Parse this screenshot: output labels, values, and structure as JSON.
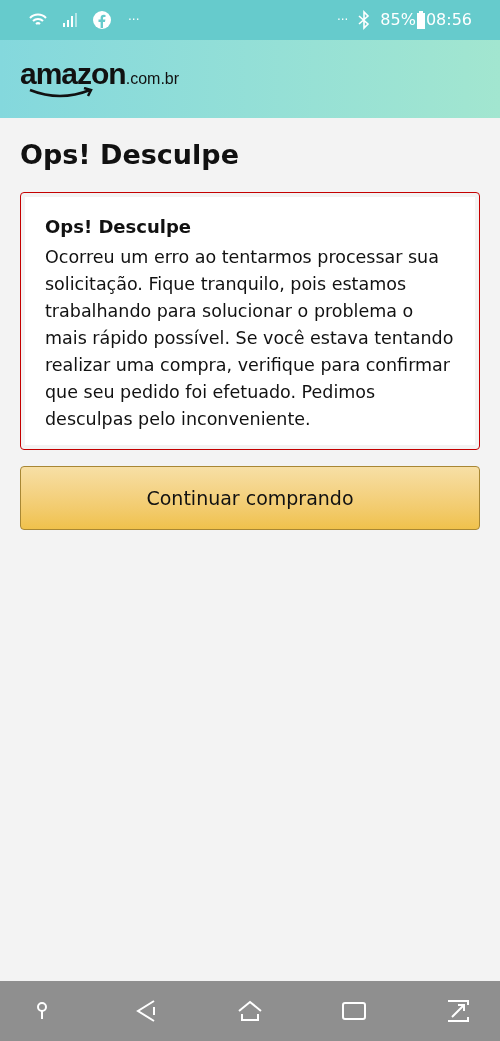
{
  "status_bar": {
    "left_more": "···",
    "right_more": "···",
    "battery": "85%",
    "time": "08:56"
  },
  "header": {
    "logo": "amazon",
    "logo_domain": ".com.br"
  },
  "page_title": "Ops! Desculpe",
  "alert": {
    "title": "Ops! Desculpe",
    "message": "Ocorreu um erro ao tentarmos processar sua solicitação. Fique tranquilo, pois estamos trabalhando para solucionar o problema o mais rápido possível. Se você estava tentando realizar uma compra, verifique para confirmar que seu pedido foi efetuado. Pedimos desculpas pelo inconveniente."
  },
  "button": {
    "label": "Continuar comprando"
  }
}
